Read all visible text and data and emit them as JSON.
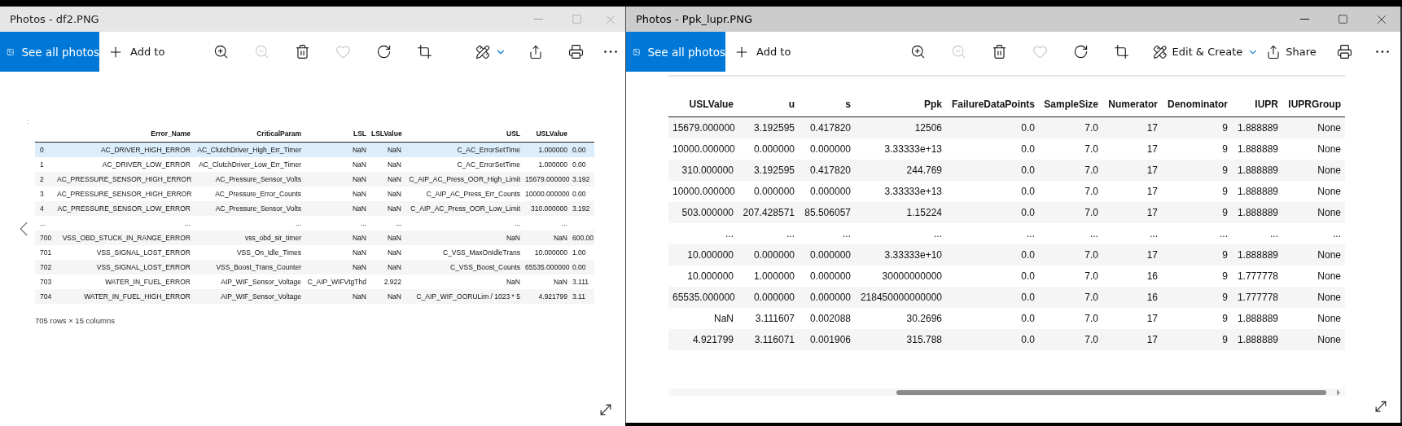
{
  "windows": [
    {
      "title_bar": {
        "title": "Photos - df2.PNG",
        "active": false
      },
      "toolbar": [
        {
          "kind": "see_all",
          "label": "See all photos",
          "disabled": false
        },
        {
          "kind": "add",
          "label": "Add to",
          "disabled": false
        },
        {
          "kind": "zoom_in",
          "disabled": false
        },
        {
          "kind": "zoom_out",
          "disabled": true
        },
        {
          "kind": "delete",
          "disabled": false
        },
        {
          "kind": "favorite",
          "disabled": true
        },
        {
          "kind": "rotate",
          "disabled": false
        },
        {
          "kind": "crop",
          "disabled": false
        },
        {
          "kind": "edit",
          "disabled": false
        },
        {
          "kind": "share",
          "disabled": false
        },
        {
          "kind": "print",
          "disabled": false
        },
        {
          "kind": "more",
          "disabled": false
        }
      ],
      "content": {
        "kind": "dataframe",
        "corner_mark": ":",
        "columns": [
          "Error_Name",
          "CriticalParam",
          "LSL",
          "LSLValue",
          "USL",
          "USLValue"
        ],
        "rows": [
          {
            "index": "0",
            "highlighted": true,
            "cells": [
              "AC_DRIVER_HIGH_ERROR",
              "AC_ClutchDriver_High_Err_Timer",
              "NaN",
              "NaN",
              "C_AC_ErrorSetTime",
              "1.000000",
              "0.00"
            ]
          },
          {
            "index": "1",
            "highlighted": false,
            "cells": [
              "AC_DRIVER_LOW_ERROR",
              "AC_ClutchDriver_Low_Err_Timer",
              "NaN",
              "NaN",
              "C_AC_ErrorSetTime",
              "1.000000",
              "0.00"
            ]
          },
          {
            "index": "2",
            "highlighted": false,
            "cells": [
              "AC_PRESSURE_SENSOR_HIGH_ERROR",
              "AC_Pressure_Sensor_Volts",
              "NaN",
              "NaN",
              "C_AIP_AC_Press_OOR_High_Limit",
              "15679.000000",
              "3.192"
            ]
          },
          {
            "index": "3",
            "highlighted": false,
            "cells": [
              "AC_PRESSURE_SENSOR_HIGH_ERROR",
              "AC_Pressure_Error_Counts",
              "NaN",
              "NaN",
              "C_AIP_AC_Press_Err_Counts",
              "10000.000000",
              "0.00"
            ]
          },
          {
            "index": "4",
            "highlighted": false,
            "cells": [
              "AC_PRESSURE_SENSOR_LOW_ERROR",
              "AC_Pressure_Sensor_Volts",
              "NaN",
              "NaN",
              "C_AIP_AC_Press_OOR_Low_Limit",
              "310.000000",
              "3.192"
            ]
          },
          {
            "index": "...",
            "highlighted": false,
            "cells": [
              "...",
              "...",
              "...",
              "...",
              "...",
              "..."
            ]
          },
          {
            "index": "700",
            "highlighted": false,
            "cells": [
              "VSS_OBD_STUCK_IN_RANGE_ERROR",
              "vss_obd_sir_timer",
              "NaN",
              "NaN",
              "NaN",
              "NaN",
              "600.00"
            ]
          },
          {
            "index": "701",
            "highlighted": false,
            "cells": [
              "VSS_SIGNAL_LOST_ERROR",
              "VSS_On_Idle_Times",
              "NaN",
              "NaN",
              "C_VSS_MaxOnIdleTrans",
              "10.000000",
              "1.00"
            ]
          },
          {
            "index": "702",
            "highlighted": false,
            "cells": [
              "VSS_SIGNAL_LOST_ERROR",
              "VSS_Boost_Trans_Counter",
              "NaN",
              "NaN",
              "C_VSS_Boost_Counts",
              "65535.000000",
              "0.00"
            ]
          },
          {
            "index": "703",
            "highlighted": false,
            "cells": [
              "WATER_IN_FUEL_ERROR",
              "AIP_WIF_Sensor_Voltage",
              "C_AIP_WIFVtgThd",
              "2.922",
              "NaN",
              "NaN",
              "3.111"
            ]
          },
          {
            "index": "704",
            "highlighted": false,
            "cells": [
              "WATER_IN_FUEL_HIGH_ERROR",
              "AIP_WIF_Sensor_Voltage",
              "NaN",
              "NaN",
              "C_AIP_WIF_OORULim / 1023 * 5",
              "4.921799",
              "3.11"
            ]
          }
        ],
        "footer": "705 rows × 15 columns"
      }
    },
    {
      "title_bar": {
        "title": "Photos - Ppk_lupr.PNG",
        "active": true
      },
      "toolbar": [
        {
          "kind": "see_all",
          "label": "See all photos",
          "disabled": false
        },
        {
          "kind": "add",
          "label": "Add to",
          "disabled": false
        },
        {
          "kind": "zoom_in",
          "disabled": false
        },
        {
          "kind": "zoom_out",
          "disabled": true
        },
        {
          "kind": "delete",
          "disabled": false
        },
        {
          "kind": "favorite",
          "disabled": true
        },
        {
          "kind": "rotate",
          "disabled": false
        },
        {
          "kind": "crop",
          "disabled": false
        },
        {
          "kind": "edit",
          "label": "Edit & Create",
          "disabled": false
        },
        {
          "kind": "share",
          "label": "Share",
          "disabled": false
        },
        {
          "kind": "print",
          "disabled": false
        },
        {
          "kind": "more",
          "disabled": false
        }
      ],
      "content": {
        "kind": "table",
        "columns": [
          "USLValue",
          "u",
          "s",
          "Ppk",
          "FailureDataPoints",
          "SampleSize",
          "Numerator",
          "Denominator",
          "IUPR",
          "IUPRGroup"
        ],
        "rows": [
          {
            "cells": [
              "15679.000000",
              "3.192595",
              "0.417820",
              "12506",
              "0.0",
              "7.0",
              "17",
              "9",
              "1.888889",
              "None"
            ]
          },
          {
            "cells": [
              "10000.000000",
              "0.000000",
              "0.000000",
              "3.33333e+13",
              "0.0",
              "7.0",
              "17",
              "9",
              "1.888889",
              "None"
            ]
          },
          {
            "cells": [
              "310.000000",
              "3.192595",
              "0.417820",
              "244.769",
              "0.0",
              "7.0",
              "17",
              "9",
              "1.888889",
              "None"
            ]
          },
          {
            "cells": [
              "10000.000000",
              "0.000000",
              "0.000000",
              "3.33333e+13",
              "0.0",
              "7.0",
              "17",
              "9",
              "1.888889",
              "None"
            ]
          },
          {
            "cells": [
              "503.000000",
              "207.428571",
              "85.506057",
              "1.15224",
              "0.0",
              "7.0",
              "17",
              "9",
              "1.888889",
              "None"
            ]
          },
          {
            "cells": [
              "...",
              "...",
              "...",
              "...",
              "...",
              "...",
              "...",
              "...",
              "...",
              "..."
            ]
          },
          {
            "cells": [
              "10.000000",
              "0.000000",
              "0.000000",
              "3.33333e+10",
              "0.0",
              "7.0",
              "17",
              "9",
              "1.888889",
              "None"
            ]
          },
          {
            "cells": [
              "10.000000",
              "1.000000",
              "0.000000",
              "30000000000",
              "0.0",
              "7.0",
              "16",
              "9",
              "1.777778",
              "None"
            ]
          },
          {
            "cells": [
              "65535.000000",
              "0.000000",
              "0.000000",
              "218450000000000",
              "0.0",
              "7.0",
              "16",
              "9",
              "1.777778",
              "None"
            ]
          },
          {
            "cells": [
              "NaN",
              "3.111607",
              "0.002088",
              "30.2696",
              "0.0",
              "7.0",
              "17",
              "9",
              "1.888889",
              "None"
            ]
          },
          {
            "cells": [
              "4.921799",
              "3.116071",
              "0.001906",
              "315.788",
              "0.0",
              "7.0",
              "17",
              "9",
              "1.888889",
              "None"
            ]
          }
        ]
      }
    }
  ]
}
